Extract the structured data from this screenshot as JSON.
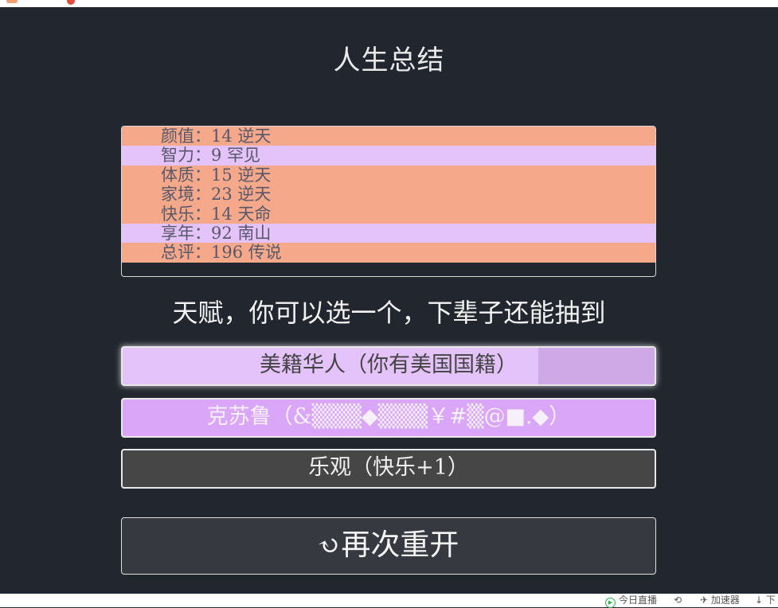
{
  "page": {
    "title": "人生总结",
    "subtitle": "天赋，你可以选一个，下辈子还能抽到"
  },
  "summary": [
    {
      "label": "颜值：14 逆天",
      "grade": "common"
    },
    {
      "label": "智力：9 罕见",
      "grade": "rare"
    },
    {
      "label": "体质：15 逆天",
      "grade": "common"
    },
    {
      "label": "家境：23 逆天",
      "grade": "common"
    },
    {
      "label": "快乐：14 天命",
      "grade": "common"
    },
    {
      "label": "享年：92 南山",
      "grade": "rare"
    },
    {
      "label": "总评：196 传说",
      "grade": "common"
    }
  ],
  "talents": [
    {
      "label": "美籍华人（你有美国国籍）"
    },
    {
      "label": "克苏鲁（&▒▒▒◆▒▒▒￥#▒@■.◆）"
    },
    {
      "label": "乐观（快乐+1）"
    }
  ],
  "restart": {
    "icon": "↻",
    "label": "再次重开"
  },
  "statusbar": {
    "live": "今日直播",
    "accelerator": "加速器",
    "download": "下"
  },
  "colors": {
    "background": "#22272f",
    "grade_common": "#f5a98a",
    "grade_rare": "#e4c2fa",
    "talent_selected": "#e4c2fa",
    "talent_legendary": "#daa6f7",
    "talent_normal": "#464646"
  }
}
